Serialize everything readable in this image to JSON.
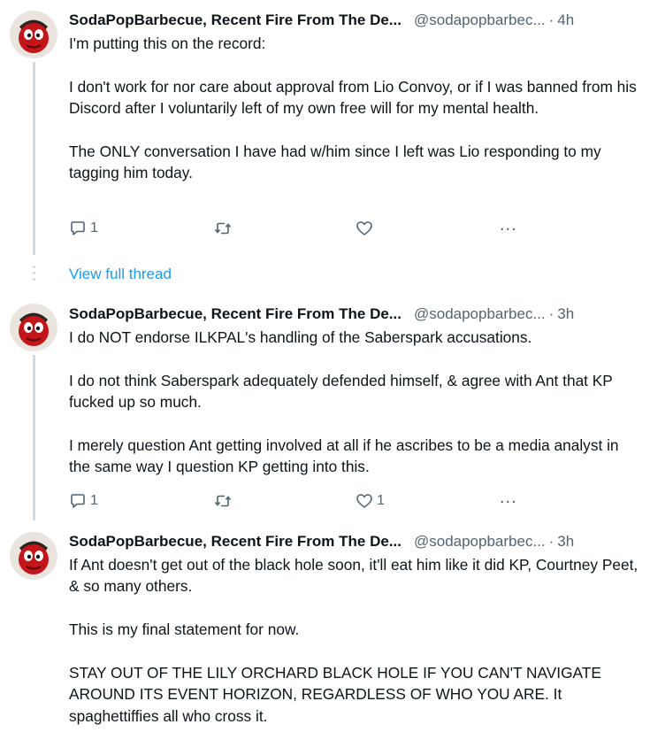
{
  "tweets": [
    {
      "name": "SodaPopBarbecue, Recent Fire From The De...",
      "handle": "@sodapopbarbec...",
      "separator": "·",
      "time": "4h",
      "text": "I'm putting this on the record:\n\nI don't work for nor care about approval from Lio Convoy, or if I was banned from his Discord after I voluntarily left of my own free will for my mental health.\n\nThe ONLY conversation I have had w/him since I left was Lio responding to my tagging him today.",
      "replies": "1",
      "retweets": "",
      "likes": "",
      "more": "..."
    },
    {
      "name": "SodaPopBarbecue, Recent Fire From The De...",
      "handle": "@sodapopbarbec...",
      "separator": "·",
      "time": "3h",
      "text": "I do NOT endorse ILKPAL's handling of the Saberspark accusations.\n\nI do not think Saberspark adequately defended himself, & agree with Ant that KP fucked up so much.\n\nI merely question Ant getting involved at all if he ascribes to be a media analyst in the same way I question KP getting into this.",
      "replies": "1",
      "retweets": "",
      "likes": "1",
      "more": "..."
    },
    {
      "name": "SodaPopBarbecue, Recent Fire From The De...",
      "handle": "@sodapopbarbec...",
      "separator": "·",
      "time": "3h",
      "text": "If Ant doesn't get out of the black hole soon, it'll eat him like it did KP, Courtney Peet, & so many others.\n\nThis is my final statement for now.\n\nSTAY OUT OF THE LILY ORCHARD BLACK HOLE IF YOU CAN'T NAVIGATE AROUND ITS EVENT HORIZON, REGARDLESS OF WHO YOU ARE. It spaghettiffies all who cross it."
    }
  ],
  "view_full_thread": "View full thread",
  "colors": {
    "accent": "#1d9bf0",
    "muted": "#536471",
    "text": "#0f1419",
    "thread_line": "#cfd9de"
  },
  "icons": {
    "reply": "speech-bubble-icon",
    "retweet": "retweet-arrows-icon",
    "like": "heart-icon",
    "more": "ellipsis-icon"
  }
}
